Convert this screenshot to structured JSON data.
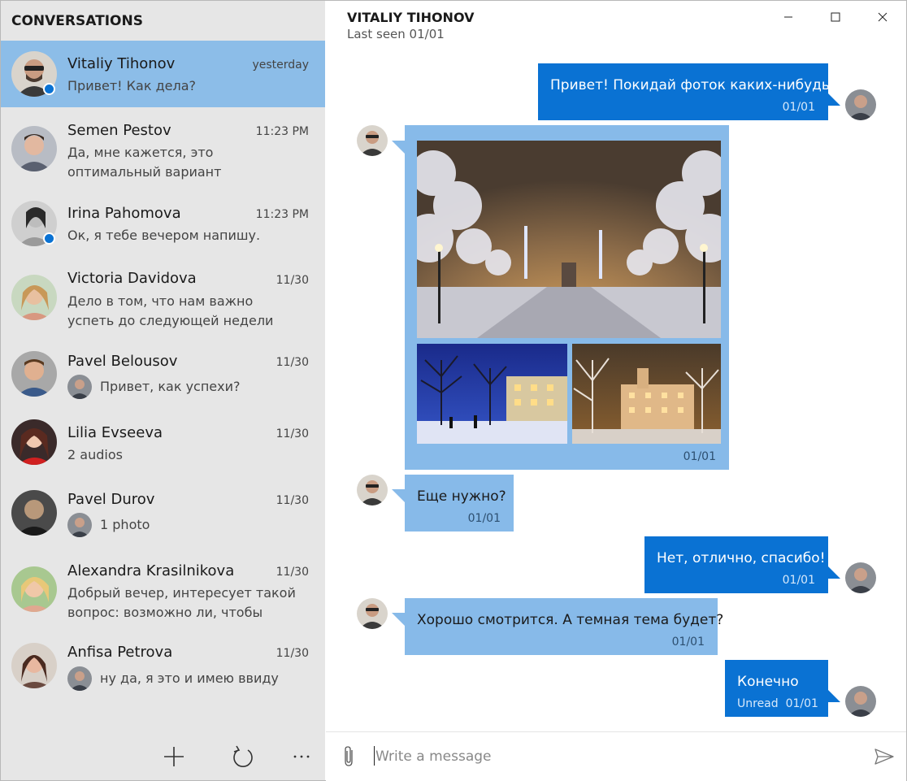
{
  "sidebar": {
    "title": "CONVERSATIONS",
    "conversations": [
      {
        "name": "Vitaliy Tihonov",
        "time": "yesterday",
        "message": "Привет! Как дела?",
        "online": true,
        "active": true
      },
      {
        "name": "Semen Pestov",
        "time": "11:23 PM",
        "message": "Да, мне кажется, это оптимальный вариант",
        "online": false
      },
      {
        "name": "Irina Pahomova",
        "time": "11:23 PM",
        "message": "Ок, я тебе вечером напишу.",
        "online": true
      },
      {
        "name": "Victoria Davidova",
        "time": "11/30",
        "message": "Дело в том, что нам важно успеть до следующей недели",
        "online": false
      },
      {
        "name": "Pavel Belousov",
        "time": "11/30",
        "message": "Привет, как успехи?",
        "from_me": true
      },
      {
        "name": "Lilia Evseeva",
        "time": "11/30",
        "message": "2 audios"
      },
      {
        "name": "Pavel Durov",
        "time": "11/30",
        "message": "1 photo",
        "from_me": true
      },
      {
        "name": "Alexandra Krasilnikova",
        "time": "11/30",
        "message": "Добрый вечер, интересует такой вопрос: возможно ли, чтобы"
      },
      {
        "name": "Anfisa Petrova",
        "time": "11/30",
        "message": "ну да, я это и имею ввиду",
        "from_me": true
      }
    ],
    "toolbar": {
      "add_icon": "plus-icon",
      "refresh_icon": "refresh-icon",
      "more_icon": "more-icon"
    }
  },
  "chat": {
    "title": "VITALIY TIHONOV",
    "subtitle": "Last seen 01/01",
    "messages": [
      {
        "direction": "out",
        "text": "Привет! Покидай фоток каких-нибудь",
        "time": "01/01"
      },
      {
        "direction": "in",
        "type": "photos",
        "count": 3,
        "time": "01/01"
      },
      {
        "direction": "in",
        "text": "Еще нужно?",
        "time": "01/01"
      },
      {
        "direction": "out",
        "text": "Нет, отлично, спасибо!",
        "time": "01/01"
      },
      {
        "direction": "in",
        "text": "Хорошо смотрится. А темная тема будет?",
        "time": "01/01"
      },
      {
        "direction": "out",
        "text": "Конечно",
        "time": "01/01",
        "status": "Unread"
      }
    ]
  },
  "composer": {
    "placeholder": "Write a message",
    "value": ""
  },
  "colors": {
    "sidebar_bg": "#e6e6e6",
    "active_item": "#8cbde8",
    "outgoing": "#0a72d3",
    "incoming": "#87bae9",
    "online_dot": "#0a72d3"
  }
}
